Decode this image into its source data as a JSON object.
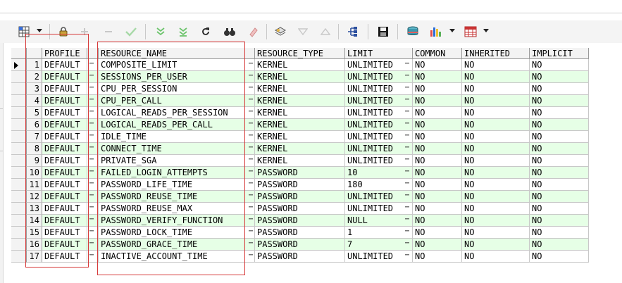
{
  "colors": {
    "row_alt": "#e6ffe6",
    "row_default": "#ffffff",
    "highlight_border": "#d63a3a"
  },
  "toolbar": {
    "icons": [
      "grid-view-icon",
      "lock-icon",
      "add-record-icon",
      "remove-record-icon",
      "post-changes-icon",
      "fetch-next-icon",
      "fetch-last-icon",
      "refresh-icon",
      "find-icon",
      "clear-icon",
      "query-by-example-icon",
      "filter-icon",
      "sort-icon",
      "explain-plan-icon",
      "save-icon",
      "export-icon",
      "chart-icon",
      "table-view-icon"
    ]
  },
  "grid": {
    "columns": [
      "PROFILE",
      "RESOURCE_NAME",
      "RESOURCE_TYPE",
      "LIMIT",
      "COMMON",
      "INHERITED",
      "IMPLICIT"
    ],
    "rows": [
      {
        "num": "1",
        "profile": "DEFAULT",
        "resource_name": "COMPOSITE_LIMIT",
        "resource_type": "KERNEL",
        "limit": "UNLIMITED",
        "common": "NO",
        "inherited": "NO",
        "implicit": "NO"
      },
      {
        "num": "2",
        "profile": "DEFAULT",
        "resource_name": "SESSIONS_PER_USER",
        "resource_type": "KERNEL",
        "limit": "UNLIMITED",
        "common": "NO",
        "inherited": "NO",
        "implicit": "NO"
      },
      {
        "num": "3",
        "profile": "DEFAULT",
        "resource_name": "CPU_PER_SESSION",
        "resource_type": "KERNEL",
        "limit": "UNLIMITED",
        "common": "NO",
        "inherited": "NO",
        "implicit": "NO"
      },
      {
        "num": "4",
        "profile": "DEFAULT",
        "resource_name": "CPU_PER_CALL",
        "resource_type": "KERNEL",
        "limit": "UNLIMITED",
        "common": "NO",
        "inherited": "NO",
        "implicit": "NO"
      },
      {
        "num": "5",
        "profile": "DEFAULT",
        "resource_name": "LOGICAL_READS_PER_SESSION",
        "resource_type": "KERNEL",
        "limit": "UNLIMITED",
        "common": "NO",
        "inherited": "NO",
        "implicit": "NO"
      },
      {
        "num": "6",
        "profile": "DEFAULT",
        "resource_name": "LOGICAL_READS_PER_CALL",
        "resource_type": "KERNEL",
        "limit": "UNLIMITED",
        "common": "NO",
        "inherited": "NO",
        "implicit": "NO"
      },
      {
        "num": "7",
        "profile": "DEFAULT",
        "resource_name": "IDLE_TIME",
        "resource_type": "KERNEL",
        "limit": "UNLIMITED",
        "common": "NO",
        "inherited": "NO",
        "implicit": "NO"
      },
      {
        "num": "8",
        "profile": "DEFAULT",
        "resource_name": "CONNECT_TIME",
        "resource_type": "KERNEL",
        "limit": "UNLIMITED",
        "common": "NO",
        "inherited": "NO",
        "implicit": "NO"
      },
      {
        "num": "9",
        "profile": "DEFAULT",
        "resource_name": "PRIVATE_SGA",
        "resource_type": "KERNEL",
        "limit": "UNLIMITED",
        "common": "NO",
        "inherited": "NO",
        "implicit": "NO"
      },
      {
        "num": "10",
        "profile": "DEFAULT",
        "resource_name": "FAILED_LOGIN_ATTEMPTS",
        "resource_type": "PASSWORD",
        "limit": "10",
        "common": "NO",
        "inherited": "NO",
        "implicit": "NO"
      },
      {
        "num": "11",
        "profile": "DEFAULT",
        "resource_name": "PASSWORD_LIFE_TIME",
        "resource_type": "PASSWORD",
        "limit": "180",
        "common": "NO",
        "inherited": "NO",
        "implicit": "NO"
      },
      {
        "num": "12",
        "profile": "DEFAULT",
        "resource_name": "PASSWORD_REUSE_TIME",
        "resource_type": "PASSWORD",
        "limit": "UNLIMITED",
        "common": "NO",
        "inherited": "NO",
        "implicit": "NO"
      },
      {
        "num": "13",
        "profile": "DEFAULT",
        "resource_name": "PASSWORD_REUSE_MAX",
        "resource_type": "PASSWORD",
        "limit": "UNLIMITED",
        "common": "NO",
        "inherited": "NO",
        "implicit": "NO"
      },
      {
        "num": "14",
        "profile": "DEFAULT",
        "resource_name": "PASSWORD_VERIFY_FUNCTION",
        "resource_type": "PASSWORD",
        "limit": "NULL",
        "common": "NO",
        "inherited": "NO",
        "implicit": "NO"
      },
      {
        "num": "15",
        "profile": "DEFAULT",
        "resource_name": "PASSWORD_LOCK_TIME",
        "resource_type": "PASSWORD",
        "limit": "1",
        "common": "NO",
        "inherited": "NO",
        "implicit": "NO"
      },
      {
        "num": "16",
        "profile": "DEFAULT",
        "resource_name": "PASSWORD_GRACE_TIME",
        "resource_type": "PASSWORD",
        "limit": "7",
        "common": "NO",
        "inherited": "NO",
        "implicit": "NO"
      },
      {
        "num": "17",
        "profile": "DEFAULT",
        "resource_name": "INACTIVE_ACCOUNT_TIME",
        "resource_type": "PASSWORD",
        "limit": "UNLIMITED",
        "common": "NO",
        "inherited": "NO",
        "implicit": "NO"
      }
    ]
  }
}
